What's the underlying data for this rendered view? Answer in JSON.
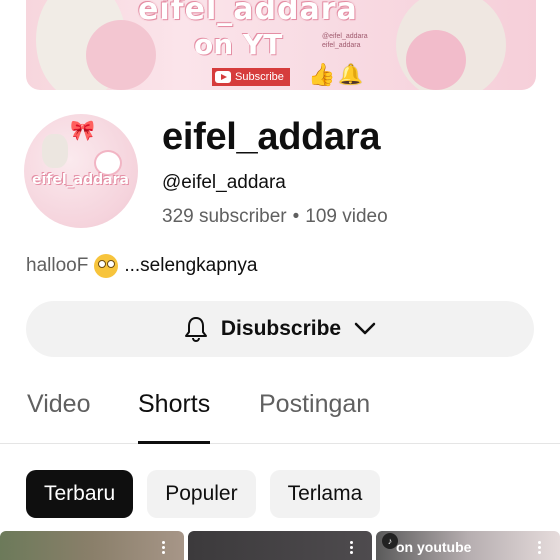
{
  "banner": {
    "title_line1": "eifel_addara",
    "title_line2": "on YT",
    "small_text_1": "@eifel_addara",
    "small_text_2": "eifel_addara",
    "subscribe_label": "Subscribe",
    "like_icon": "thumbs-up-icon",
    "bell_icon": "bell-icon"
  },
  "avatar": {
    "text": "eifel_addara"
  },
  "channel": {
    "name": "eifel_addara",
    "handle": "@eifel_addara",
    "subscribers": "329 subscriber",
    "separator": "•",
    "videos": "109 video"
  },
  "description": {
    "text": "hallooF",
    "emoji": "flushed-face-icon",
    "more": "...selengkapnya"
  },
  "subscribe_button": {
    "label": "Disubscribe",
    "icon": "bell-icon",
    "dropdown_icon": "chevron-down-icon"
  },
  "tabs": [
    {
      "label": "Video",
      "active": false
    },
    {
      "label": "Shorts",
      "active": true
    },
    {
      "label": "Postingan",
      "active": false
    }
  ],
  "chips": [
    {
      "label": "Terbaru",
      "active": true
    },
    {
      "label": "Populer",
      "active": false
    },
    {
      "label": "Terlama",
      "active": false
    }
  ],
  "thumbnails": [
    {
      "caption": ""
    },
    {
      "caption": ""
    },
    {
      "caption": "on youtube"
    }
  ],
  "colors": {
    "accent_red": "#d63c3c",
    "text_primary": "#0f0f0f",
    "text_secondary": "#606060",
    "chip_bg": "#f2f2f2"
  }
}
